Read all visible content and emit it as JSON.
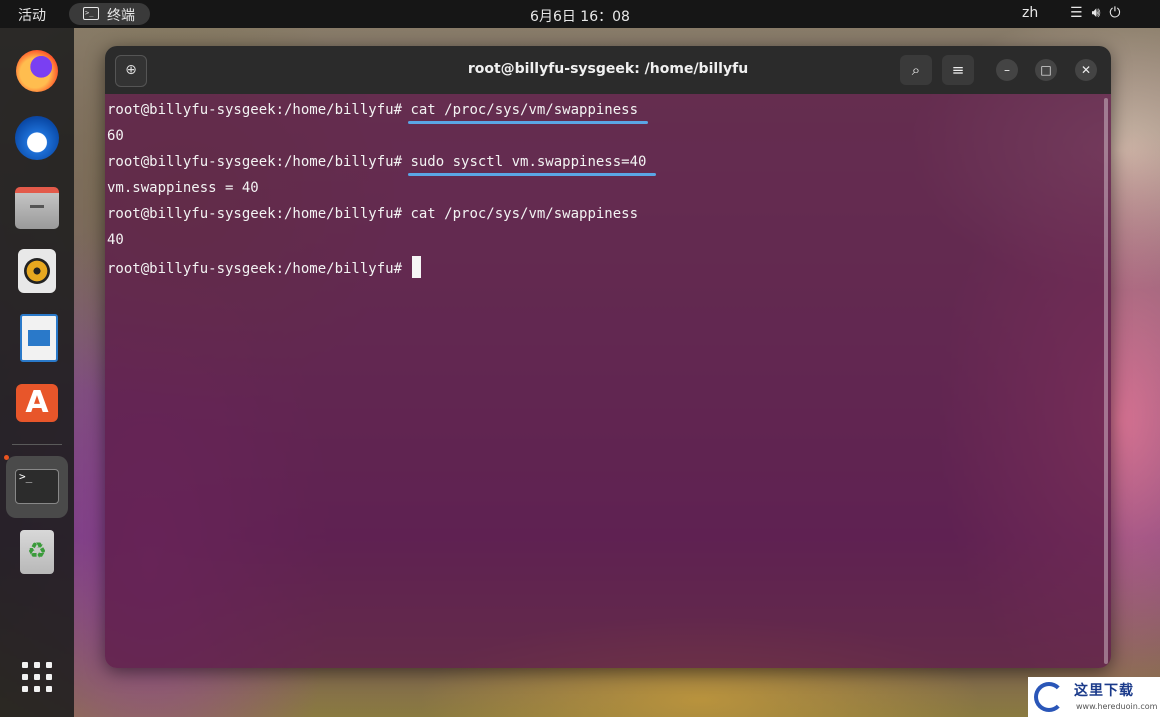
{
  "topbar": {
    "activities": "活动",
    "app_name": "终端",
    "clock": "6月6日  16：08",
    "lang": "zh",
    "tray_icons": [
      "network-icon",
      "volume-icon",
      "power-icon"
    ]
  },
  "dock": {
    "items": [
      "firefox",
      "thunderbird",
      "files",
      "rhythmbox",
      "libreoffice-writer",
      "ubuntu-software",
      "terminal",
      "trash",
      "show-apps"
    ]
  },
  "window": {
    "title": "root@billyfu-sysgeek: /home/billyfu",
    "lines": [
      {
        "prompt": "root@billyfu-sysgeek:/home/billyfu# ",
        "command": "cat /proc/sys/vm/swappiness",
        "highlighted": true
      },
      {
        "output": "60"
      },
      {
        "prompt": "root@billyfu-sysgeek:/home/billyfu# ",
        "command": "sudo sysctl vm.swappiness=40",
        "highlighted": true
      },
      {
        "output": "vm.swappiness = 40"
      },
      {
        "prompt": "root@billyfu-sysgeek:/home/billyfu# ",
        "command": "cat /proc/sys/vm/swappiness",
        "highlighted": false
      },
      {
        "output": "40"
      },
      {
        "prompt": "root@billyfu-sysgeek:/home/billyfu# ",
        "command": "",
        "cursor": true
      }
    ]
  },
  "watermark": {
    "text": "这里下载",
    "url": "www.hereduoin.com"
  },
  "colors": {
    "accent_underline": "#5aa6e6",
    "terminal_bg": "#5c1c48",
    "titlebar": "#2b2b2b",
    "ubuntu_orange": "#e95420"
  }
}
